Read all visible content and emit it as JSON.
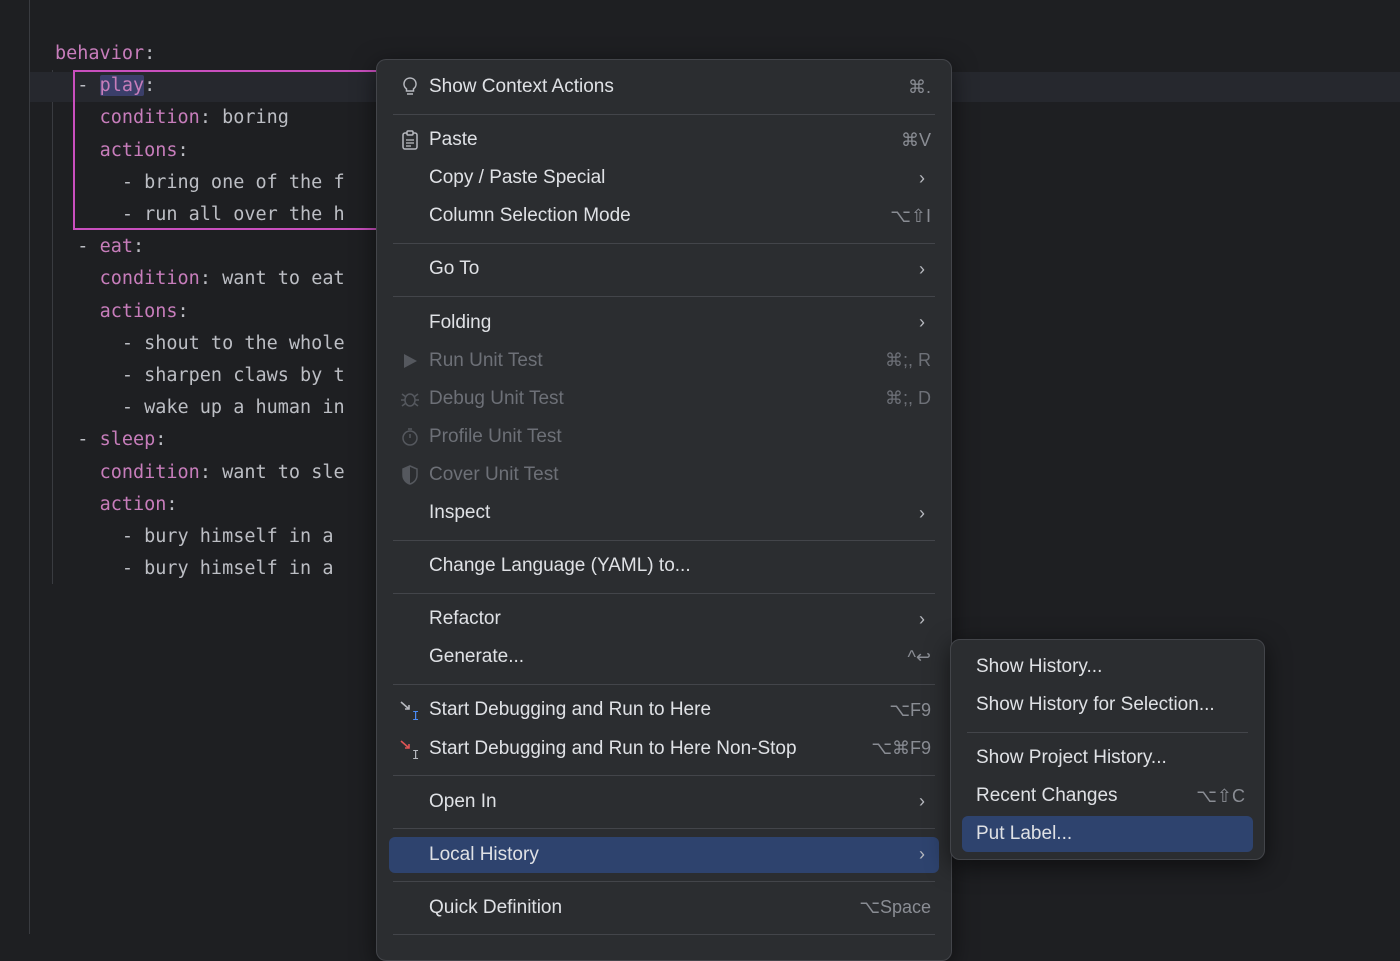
{
  "editor": {
    "lines": [
      {
        "key": "behavior",
        "indent": "",
        "dash": false,
        "rest": ""
      },
      {
        "key": "play",
        "indent": "  ",
        "dash": true,
        "rest": "",
        "highlight": true
      },
      {
        "key": "condition",
        "indent": "    ",
        "dash": false,
        "rest": " boring"
      },
      {
        "key": "actions",
        "indent": "    ",
        "dash": false,
        "rest": ""
      },
      {
        "key": "",
        "indent": "      ",
        "dash": true,
        "rest": "bring one of the f"
      },
      {
        "key": "",
        "indent": "      ",
        "dash": true,
        "rest": "run all over the h"
      },
      {
        "key": "eat",
        "indent": "  ",
        "dash": true,
        "rest": ""
      },
      {
        "key": "condition",
        "indent": "    ",
        "dash": false,
        "rest": " want to eat"
      },
      {
        "key": "actions",
        "indent": "    ",
        "dash": false,
        "rest": ""
      },
      {
        "key": "",
        "indent": "      ",
        "dash": true,
        "rest": "shout to the whole"
      },
      {
        "key": "",
        "indent": "      ",
        "dash": true,
        "rest": "sharpen claws by t"
      },
      {
        "key": "",
        "indent": "      ",
        "dash": true,
        "rest": "wake up a human in"
      },
      {
        "key": "sleep",
        "indent": "  ",
        "dash": true,
        "rest": ""
      },
      {
        "key": "condition",
        "indent": "    ",
        "dash": false,
        "rest": " want to sle"
      },
      {
        "key": "action",
        "indent": "    ",
        "dash": false,
        "rest": ""
      },
      {
        "key": "",
        "indent": "      ",
        "dash": true,
        "rest": "bury himself in a"
      },
      {
        "key": "",
        "indent": "      ",
        "dash": true,
        "rest": "bury himself in a"
      }
    ]
  },
  "context_menu": {
    "items": [
      {
        "label": "Show Context Actions",
        "shortcut": "⌘.",
        "icon": "lightbulb-icon"
      },
      {
        "separator": true
      },
      {
        "label": "Paste",
        "shortcut": "⌘V",
        "icon": "clipboard-icon"
      },
      {
        "label": "Copy / Paste Special",
        "submenu": true
      },
      {
        "label": "Column Selection Mode",
        "shortcut": "⌥⇧I"
      },
      {
        "separator": true
      },
      {
        "label": "Go To",
        "submenu": true
      },
      {
        "separator": true
      },
      {
        "label": "Folding",
        "submenu": true
      },
      {
        "label": "Run Unit Test",
        "shortcut": "⌘;, R",
        "icon": "run-icon",
        "disabled": true
      },
      {
        "label": "Debug Unit Test",
        "shortcut": "⌘;, D",
        "icon": "bug-icon",
        "disabled": true
      },
      {
        "label": "Profile Unit Test",
        "icon": "stopwatch-icon",
        "disabled": true
      },
      {
        "label": "Cover Unit Test",
        "icon": "shield-icon",
        "disabled": true
      },
      {
        "label": "Inspect",
        "submenu": true
      },
      {
        "separator": true
      },
      {
        "label": "Change Language (YAML) to..."
      },
      {
        "separator": true
      },
      {
        "label": "Refactor",
        "submenu": true
      },
      {
        "label": "Generate...",
        "shortcut": "^↩"
      },
      {
        "separator": true
      },
      {
        "label": "Start Debugging and Run to Here",
        "shortcut": "⌥F9",
        "icon": "run-to-cursor-icon"
      },
      {
        "label": "Start Debugging and Run to Here Non-Stop",
        "shortcut": "⌥⌘F9",
        "icon": "run-to-cursor-nonstop-icon"
      },
      {
        "separator": true
      },
      {
        "label": "Open In",
        "submenu": true
      },
      {
        "separator": true
      },
      {
        "label": "Local History",
        "submenu": true,
        "active": true
      },
      {
        "separator": true
      },
      {
        "label": "Quick Definition",
        "shortcut": "⌥Space"
      },
      {
        "separator": true
      }
    ]
  },
  "submenu": {
    "items": [
      {
        "label": "Show History..."
      },
      {
        "label": "Show History for Selection..."
      },
      {
        "separator": true
      },
      {
        "label": "Show Project History..."
      },
      {
        "label": "Recent Changes",
        "shortcut": "⌥⇧C"
      },
      {
        "label": "Put Label...",
        "active": true
      }
    ]
  },
  "colors": {
    "background": "#1e1f22",
    "menu_bg": "#2b2d30",
    "selection": "#2e436e",
    "yaml_key": "#c77dbb",
    "selection_border": "#c94fbe"
  }
}
